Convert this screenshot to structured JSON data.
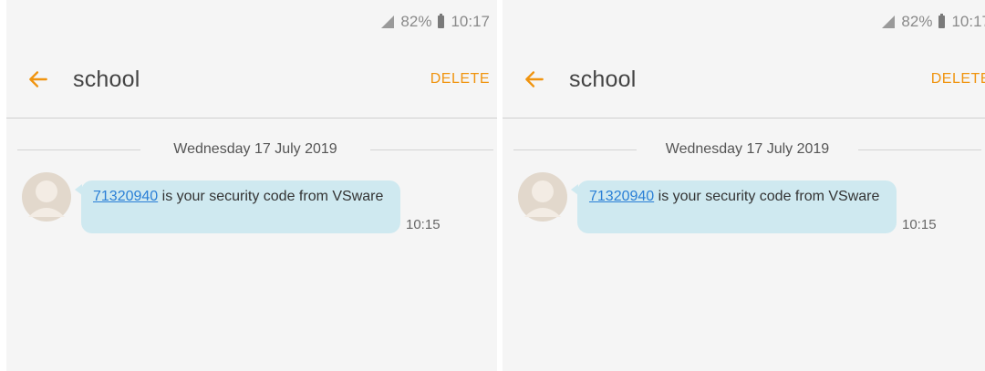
{
  "status_bar": {
    "battery": "82%",
    "time": "10:17"
  },
  "header": {
    "title": "school",
    "delete_label": "DELETE"
  },
  "conversation": {
    "date_separator": "Wednesday 17 July 2019",
    "message": {
      "code": "71320940",
      "text_after_code": " is your security code from VSware",
      "time": "10:15"
    }
  },
  "colors": {
    "accent": "#f0940f",
    "bubble": "#cfe9f0",
    "link": "#2a7fd6",
    "background": "#f5f5f5"
  }
}
